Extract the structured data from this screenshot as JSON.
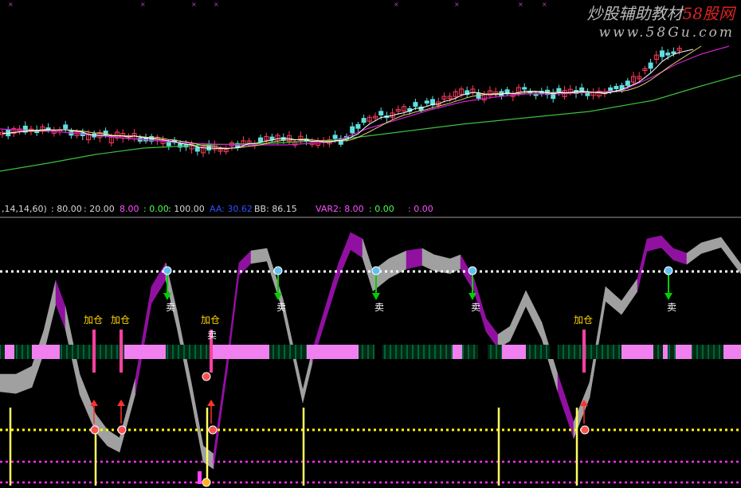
{
  "watermark": {
    "text_main": "炒股辅助教材",
    "text_brand": "58股网",
    "url": "www.58Gu.com"
  },
  "indicator_legend": {
    "params": ",14,14,60)",
    "v1": ": 80.00",
    "v2": ": 20.00",
    "v3": "8.00",
    "v4": ": 0.00",
    "v5": ": 100.00",
    "aa": "AA: 30.62",
    "bb": "BB: 86.15",
    "var2_label": "VAR2: 8.00",
    "var2_v1": ": 0.00",
    "var2_v2": ": 0.00"
  },
  "signals": {
    "add_label": "加仓",
    "sell_label": "卖"
  },
  "colors": {
    "background": "#000000",
    "candle_up": "#ff3b5c",
    "candle_down": "#5fe0e0",
    "ma_white": "#ffffff",
    "ma_yellow": "#e0d070",
    "ma_magenta": "#d020d0",
    "ma_green": "#3cc03c",
    "kdj_purple": "#9010a0",
    "kdj_gray": "#a0a0a0",
    "level_white": "#ffffff",
    "level_yellow": "#ffff00",
    "level_magenta": "#ff30ff",
    "bar_pink": "#f080f0",
    "bar_green": "#00a060",
    "signal_add": "#ffd700",
    "signal_sell": "#ffffff",
    "arrow_down": "#00d000",
    "arrow_up": "#ff3030",
    "vline_yellow": "#ffff60"
  }
}
